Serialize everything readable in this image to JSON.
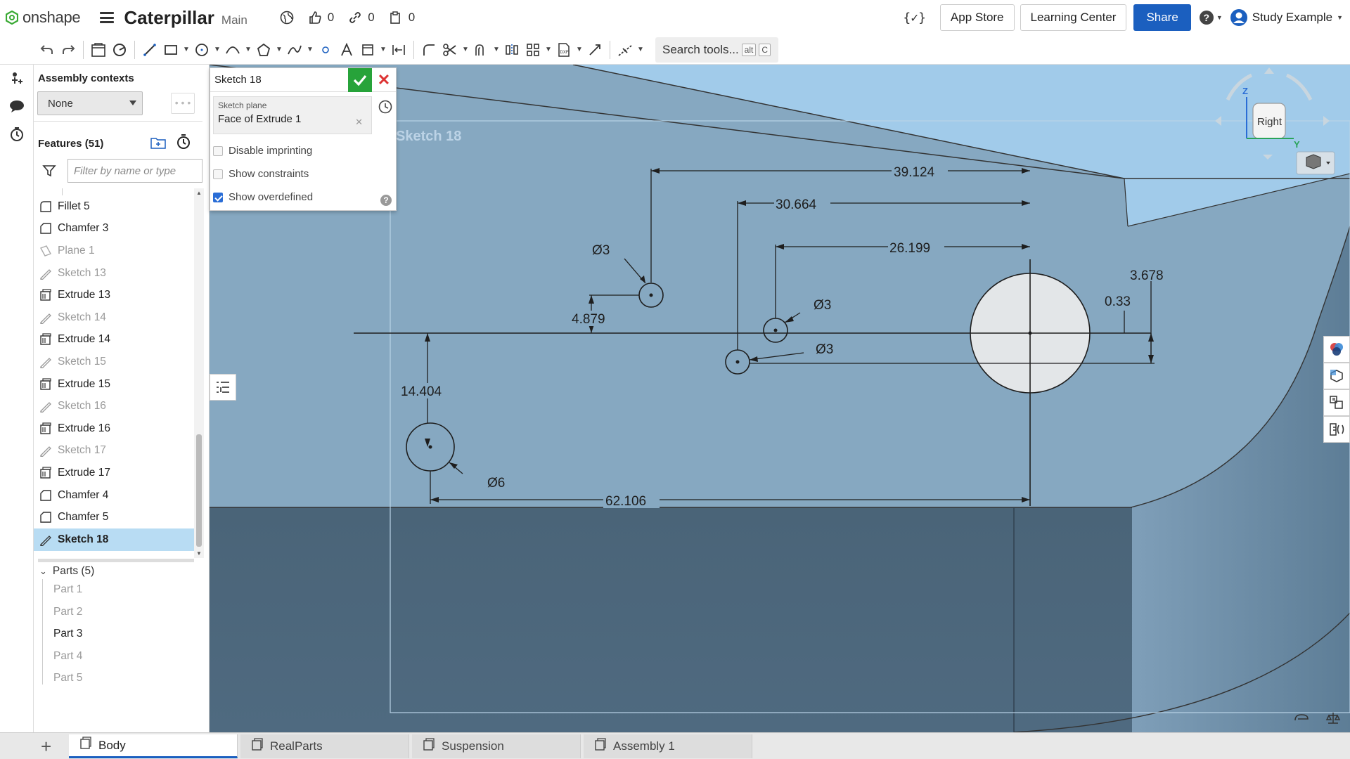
{
  "header": {
    "logo_text": "onshape",
    "doc_title": "Caterpillar",
    "workspace": "Main",
    "likes": "0",
    "links": "0",
    "copies": "0",
    "app_store": "App Store",
    "learning_center": "Learning Center",
    "share": "Share",
    "user": "Study Example"
  },
  "toolbar": {
    "search_placeholder": "Search tools...",
    "shortcut_1": "alt",
    "shortcut_2": "C"
  },
  "features_panel": {
    "assembly_contexts_label": "Assembly contexts",
    "assembly_context_value": "None",
    "features_label": "Features (51)",
    "filter_placeholder": "Filter by name or type",
    "items": [
      {
        "label": "Fillet 5",
        "type": "fillet",
        "dim": false
      },
      {
        "label": "Chamfer 3",
        "type": "chamfer",
        "dim": false
      },
      {
        "label": "Plane 1",
        "type": "plane",
        "dim": true
      },
      {
        "label": "Sketch 13",
        "type": "sketch",
        "dim": true
      },
      {
        "label": "Extrude 13",
        "type": "extrude",
        "dim": false
      },
      {
        "label": "Sketch 14",
        "type": "sketch",
        "dim": true
      },
      {
        "label": "Extrude 14",
        "type": "extrude",
        "dim": false
      },
      {
        "label": "Sketch 15",
        "type": "sketch",
        "dim": true
      },
      {
        "label": "Extrude 15",
        "type": "extrude",
        "dim": false
      },
      {
        "label": "Sketch 16",
        "type": "sketch",
        "dim": true
      },
      {
        "label": "Extrude 16",
        "type": "extrude",
        "dim": false
      },
      {
        "label": "Sketch 17",
        "type": "sketch",
        "dim": true
      },
      {
        "label": "Extrude 17",
        "type": "extrude",
        "dim": false
      },
      {
        "label": "Chamfer 4",
        "type": "chamfer",
        "dim": false
      },
      {
        "label": "Chamfer 5",
        "type": "chamfer",
        "dim": false
      },
      {
        "label": "Sketch 18",
        "type": "sketch",
        "dim": false,
        "selected": true
      }
    ],
    "parts_label": "Parts (5)",
    "parts": [
      {
        "label": "Part 1",
        "active": false
      },
      {
        "label": "Part 2",
        "active": false
      },
      {
        "label": "Part 3",
        "active": true
      },
      {
        "label": "Part 4",
        "active": false
      },
      {
        "label": "Part 5",
        "active": false
      }
    ]
  },
  "sketch_dialog": {
    "title": "Sketch 18",
    "plane_label": "Sketch plane",
    "plane_value": "Face of Extrude 1",
    "disable_imprinting": "Disable imprinting",
    "show_constraints": "Show constraints",
    "show_overdefined": "Show overdefined",
    "show_overdefined_checked": true
  },
  "viewport": {
    "sketch_label": "Sketch 18",
    "view_cube_face": "Right",
    "axis_z": "Z",
    "axis_y": "Y",
    "dimensions": {
      "d_39": "39.124",
      "d_30": "30.664",
      "d_26": "26.199",
      "d_4879": "4.879",
      "d_14404": "14.404",
      "d_62106": "62.106",
      "d_3678": "3.678",
      "d_033": "0.33",
      "dia3_a": "Ø3",
      "dia3_b": "Ø3",
      "dia3_c": "Ø3",
      "dia6": "Ø6"
    }
  },
  "tabs": [
    {
      "label": "Body",
      "active": true
    },
    {
      "label": "RealParts",
      "active": false
    },
    {
      "label": "Suspension",
      "active": false
    },
    {
      "label": "Assembly 1",
      "active": false
    }
  ],
  "colors": {
    "accent": "#1b5fbf",
    "viewport_bg": "#86a8c1",
    "selected_row": "#b8dcf3",
    "ok_green": "#27a33a"
  }
}
